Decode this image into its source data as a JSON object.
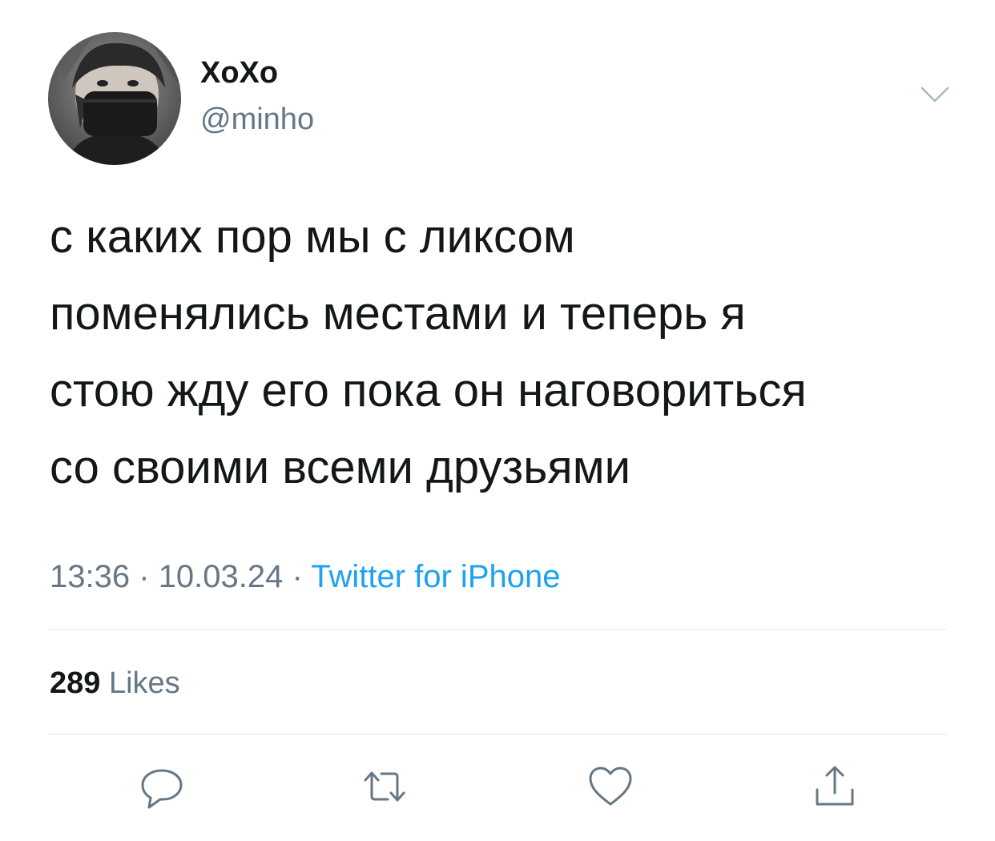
{
  "author": {
    "display_name": "XoXo",
    "handle": "@minho"
  },
  "tweet": {
    "lines": [
      "с каких пор мы с ликсом",
      "поменялись местами и теперь я",
      "стою жду его пока он наговориться",
      "со своими всеми друзьями"
    ],
    "time": "13:36",
    "date": "10.03.24",
    "separator": "·",
    "source": "Twitter for iPhone"
  },
  "stats": {
    "likes_count": "289",
    "likes_label": "Likes"
  },
  "actions": [
    {
      "icon": "reply-icon"
    },
    {
      "icon": "retweet-icon"
    },
    {
      "icon": "like-icon"
    },
    {
      "icon": "share-icon"
    }
  ],
  "colors": {
    "text": "#14171a",
    "secondary": "#657786",
    "link": "#1da1f2",
    "divider": "#e1e8ed"
  }
}
